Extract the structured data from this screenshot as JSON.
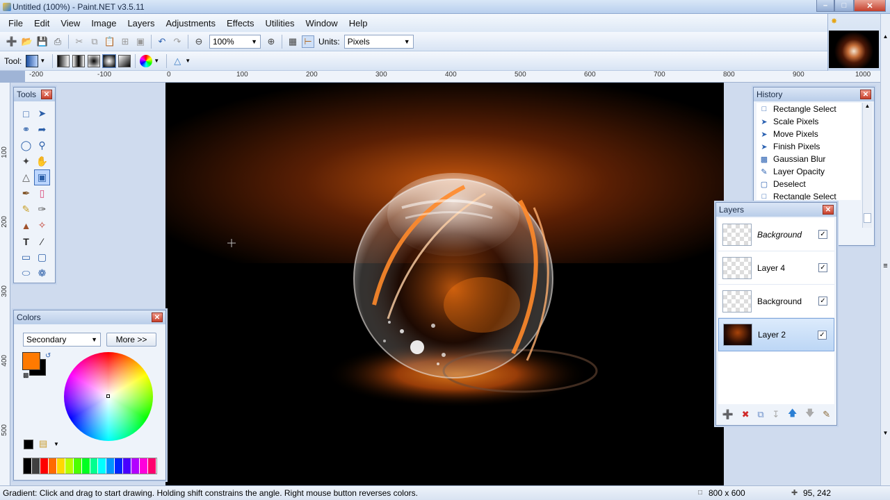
{
  "window": {
    "title": "Untitled (100%) - Paint.NET v3.5.11"
  },
  "menu": [
    "File",
    "Edit",
    "View",
    "Image",
    "Layers",
    "Adjustments",
    "Effects",
    "Utilities",
    "Window",
    "Help"
  ],
  "toolbar": {
    "zoom_value": "100%",
    "units_label": "Units:",
    "units_value": "Pixels",
    "tool_label": "Tool:"
  },
  "ruler": {
    "h_ticks": [
      "-200",
      "-100",
      "0",
      "100",
      "200",
      "300",
      "400",
      "500",
      "600",
      "700",
      "800",
      "900",
      "1000"
    ],
    "v_ticks": [
      "100",
      "200",
      "300",
      "400",
      "500"
    ]
  },
  "tools_panel": {
    "title": "Tools",
    "icons": [
      "rectangle-select",
      "move-selection",
      "lasso-select",
      "move-selected",
      "ellipse-select",
      "zoom",
      "magic-wand",
      "pan",
      "paint-bucket",
      "gradient",
      "paintbrush",
      "eraser",
      "pencil",
      "color-picker",
      "clone-stamp",
      "recolor",
      "text",
      "line-curve",
      "rectangle",
      "rounded-rectangle",
      "ellipse",
      "freeform-shape"
    ]
  },
  "colors_panel": {
    "title": "Colors",
    "mode": "Secondary",
    "more_button": "More >>",
    "primary_color": "#ff7a00",
    "secondary_color": "#000000",
    "palette": [
      "#000000",
      "#404040",
      "#ff0000",
      "#ff6a00",
      "#ffd800",
      "#b6ff00",
      "#4cff00",
      "#00ff21",
      "#00ff90",
      "#00ffff",
      "#0094ff",
      "#0026ff",
      "#4800ff",
      "#b200ff",
      "#ff00dc",
      "#ff006e"
    ]
  },
  "history_panel": {
    "title": "History",
    "items": [
      "Rectangle Select",
      "Scale Pixels",
      "Move Pixels",
      "Finish Pixels",
      "Gaussian Blur",
      "Layer Opacity",
      "Deselect",
      "Rectangle Select"
    ]
  },
  "layers_panel": {
    "title": "Layers",
    "layers": [
      {
        "name": "Background",
        "italic": true,
        "visible": true,
        "selected": false
      },
      {
        "name": "Layer 4",
        "italic": false,
        "visible": true,
        "selected": false
      },
      {
        "name": "Background",
        "italic": false,
        "visible": true,
        "selected": false
      },
      {
        "name": "Layer 2",
        "italic": false,
        "visible": true,
        "selected": true
      }
    ]
  },
  "status": {
    "message": "Gradient: Click and drag to start drawing. Holding shift constrains the angle. Right mouse button reverses colors.",
    "image_size": "800 x 600",
    "cursor_pos": "95, 242"
  }
}
